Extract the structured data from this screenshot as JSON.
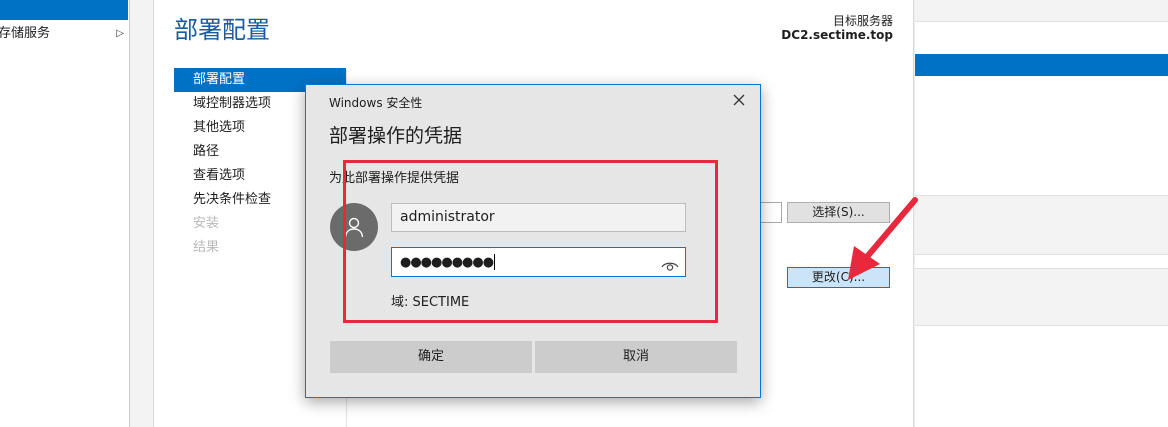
{
  "sidebar": {
    "items": [
      {
        "label": "存储服务"
      }
    ]
  },
  "wizard": {
    "title": "部署配置",
    "target_label": "目标服务器",
    "target_value": "DC2.sectime.top",
    "nav": [
      {
        "label": "部署配置",
        "state": "active"
      },
      {
        "label": "域控制器选项",
        "state": "normal"
      },
      {
        "label": "其他选项",
        "state": "normal"
      },
      {
        "label": "路径",
        "state": "normal"
      },
      {
        "label": "查看选项",
        "state": "normal"
      },
      {
        "label": "先决条件检查",
        "state": "normal"
      },
      {
        "label": "安装",
        "state": "disabled"
      },
      {
        "label": "结果",
        "state": "disabled"
      }
    ],
    "select_button": "选择(S)...",
    "change_button": "更改(C)..."
  },
  "dialog": {
    "caption": "Windows 安全性",
    "heading": "部署操作的凭据",
    "subheading": "为此部署操作提供凭据",
    "username": "administrator",
    "password_mask": "●●●●●●●●●",
    "domain": "域: SECTIME",
    "ok": "确定",
    "cancel": "取消"
  },
  "colors": {
    "accent": "#0072c6",
    "title_blue": "#1a5aa0",
    "annotation_red": "#e8283c"
  },
  "icons": [
    "chevron-right-icon",
    "close-icon",
    "user-avatar-icon",
    "eye-icon",
    "annotation-arrow"
  ]
}
